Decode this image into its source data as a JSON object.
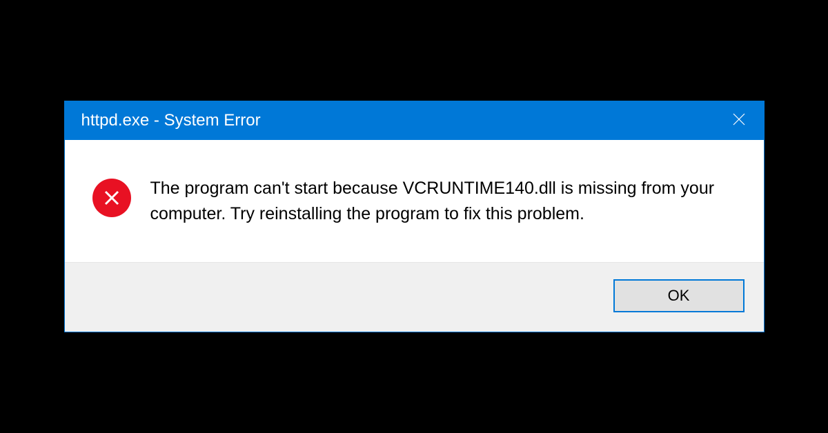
{
  "dialog": {
    "title": "httpd.exe - System Error",
    "message": "The program can't start because VCRUNTIME140.dll is missing from your computer. Try reinstalling the program to fix this problem.",
    "ok_label": "OK"
  }
}
